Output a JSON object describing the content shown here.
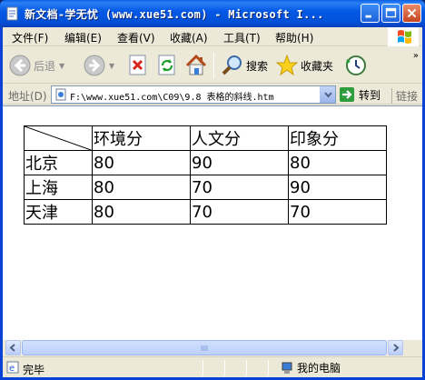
{
  "window": {
    "title": "新文档-学无忧 (www.xue51.com) - Microsoft I...",
    "accent": "#0559e6"
  },
  "menu": [
    {
      "label": "文件(F)"
    },
    {
      "label": "编辑(E)"
    },
    {
      "label": "查看(V)"
    },
    {
      "label": "收藏(A)"
    },
    {
      "label": "工具(T)"
    },
    {
      "label": "帮助(H)"
    }
  ],
  "toolbar": {
    "back_label": "后退",
    "search_label": "搜索",
    "favorites_label": "收藏夹",
    "more_glyph": "»",
    "icons": [
      "back-icon",
      "forward-icon",
      "stop-icon",
      "refresh-icon",
      "home-icon",
      "search-icon",
      "favorites-icon",
      "history-icon"
    ]
  },
  "address": {
    "label": "地址(D)",
    "value": "F:\\www.xue51.com\\C09\\9.8  表格的斜线.htm",
    "go_label": "转到",
    "links_label": "链接"
  },
  "table": {
    "headers": [
      "环境分",
      "人文分",
      "印象分"
    ],
    "rows": [
      {
        "name": "北京",
        "values": [
          "80",
          "90",
          "80"
        ]
      },
      {
        "name": "上海",
        "values": [
          "80",
          "70",
          "90"
        ]
      },
      {
        "name": "天津",
        "values": [
          "80",
          "70",
          "70"
        ]
      }
    ]
  },
  "status": {
    "text": "完毕",
    "zone": "我的电脑"
  }
}
